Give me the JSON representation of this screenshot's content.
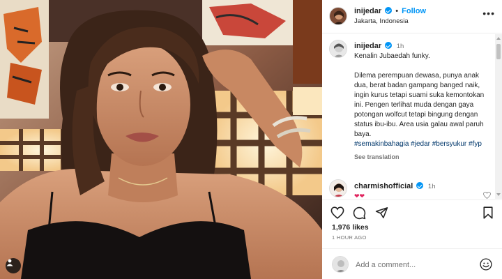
{
  "post": {
    "username": "inijedar",
    "follow_label": "Follow",
    "location": "Jakarta, Indonesia",
    "more_label": "•••"
  },
  "caption": {
    "username": "inijedar",
    "time": "1h",
    "line1": "Kenalin Jubaedah funky.",
    "body": "Dilema perempuan dewasa, punya anak dua, berat badan gampang banged naik, ingin kurus tetapi suami suka kemontokan ini. Pengen terlihat muda dengan gaya potongan wolfcut tetapi bingung dengan status ibu-ibu. Area usia galau awal paruh baya.",
    "hashtags": "#semakinbahagia #jedar #bersyukur #fyp",
    "see_translation": "See translation"
  },
  "comment": {
    "username": "charmishofficial",
    "time": "1h",
    "text": "❤❤"
  },
  "stats": {
    "likes": "1,976 likes",
    "time_ago": "1 HOUR AGO"
  },
  "composer": {
    "placeholder": "Add a comment..."
  },
  "colors": {
    "accent": "#0095f6",
    "hashtag": "#00376b",
    "muted": "#737373"
  },
  "icons": [
    "tag-user-icon",
    "heart-icon",
    "comment-icon",
    "share-icon",
    "bookmark-icon",
    "emoji-icon",
    "verified-badge-icon"
  ]
}
